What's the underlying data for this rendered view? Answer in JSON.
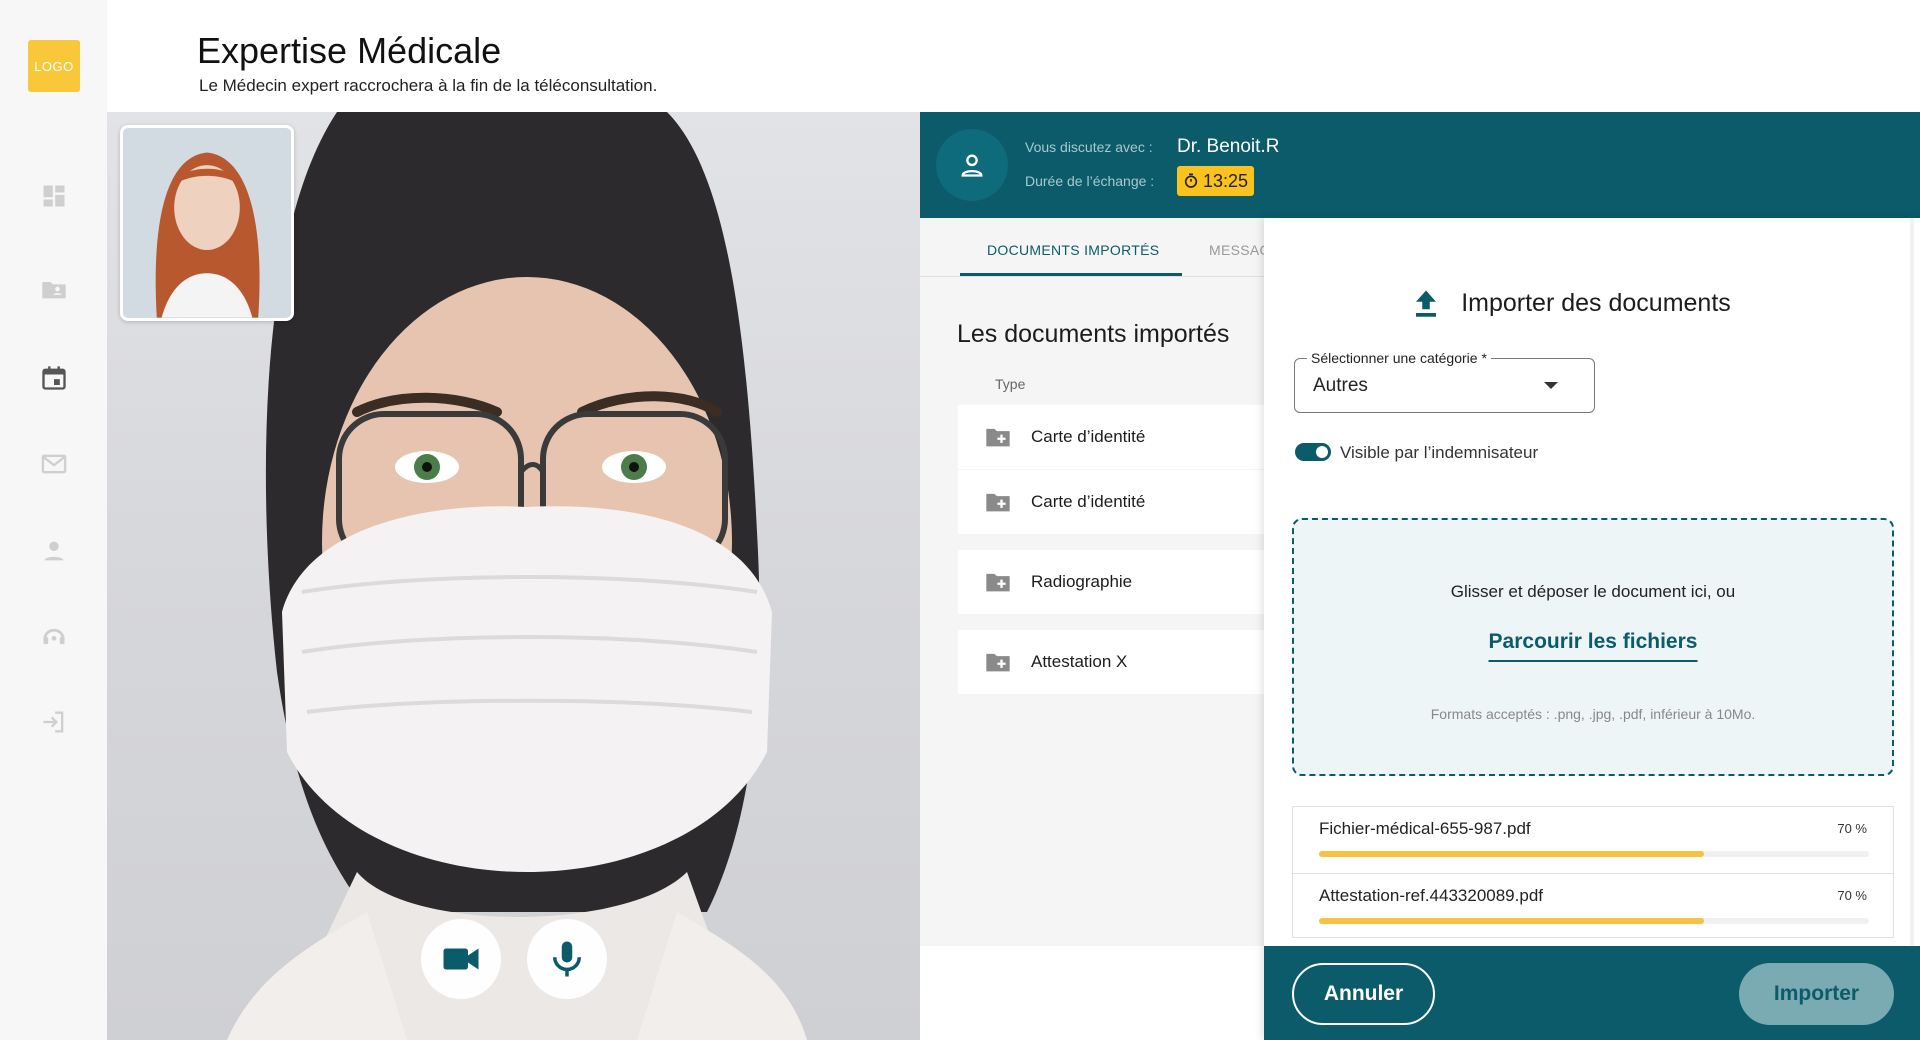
{
  "logo": "LOGO",
  "sidebar": {
    "items": [
      {
        "icon": "dashboard-icon"
      },
      {
        "icon": "folder-user-icon"
      },
      {
        "icon": "calendar-icon"
      },
      {
        "icon": "mail-icon"
      },
      {
        "icon": "user-icon"
      },
      {
        "icon": "support-icon"
      },
      {
        "icon": "logout-icon"
      }
    ]
  },
  "header": {
    "title": "Expertise Médicale",
    "subtitle": "Le Médecin expert raccrochera à la fin de la téléconsultation."
  },
  "video": {
    "controls": [
      {
        "icon": "camera-icon"
      },
      {
        "icon": "microphone-icon"
      }
    ]
  },
  "call": {
    "with_label": "Vous discutez avec :",
    "with_name": "Dr. Benoit.R",
    "duration_label": "Durée de l’échange :",
    "duration": "13:25"
  },
  "tabs": [
    {
      "label": "DOCUMENTS IMPORTÉS",
      "active": true
    },
    {
      "label": "MESSAG",
      "active": false
    }
  ],
  "documents": {
    "title": "Les documents importés",
    "column_type": "Type",
    "items": [
      {
        "name": "Carte d’identité"
      },
      {
        "name": "Carte d’identité"
      },
      {
        "name": "Radiographie"
      },
      {
        "name": "Attestation X"
      }
    ]
  },
  "import": {
    "title": "Importer des documents",
    "category_label": "Sélectionner une catégorie *",
    "category_value": "Autres",
    "visible_label": "Visible par l’indemnisateur",
    "visible_on": true,
    "drop_text": "Glisser et déposer le document ici, ou",
    "browse_label": "Parcourir les fichiers",
    "formats": "Formats acceptés : .png, .jpg, .pdf, inférieur à 10Mo.",
    "files": [
      {
        "name": "Fichier-médical-655-987.pdf",
        "progress_label": "70 %",
        "progress": 0.7
      },
      {
        "name": "Attestation-ref.443320089.pdf",
        "progress_label": "70 %",
        "progress": 0.7
      }
    ],
    "cancel_label": "Annuler",
    "import_label": "Importer"
  },
  "colors": {
    "primary": "#0b5b6a",
    "accent": "#f9c21f",
    "progress": "#f7c244",
    "logo": "#f9c83a"
  }
}
